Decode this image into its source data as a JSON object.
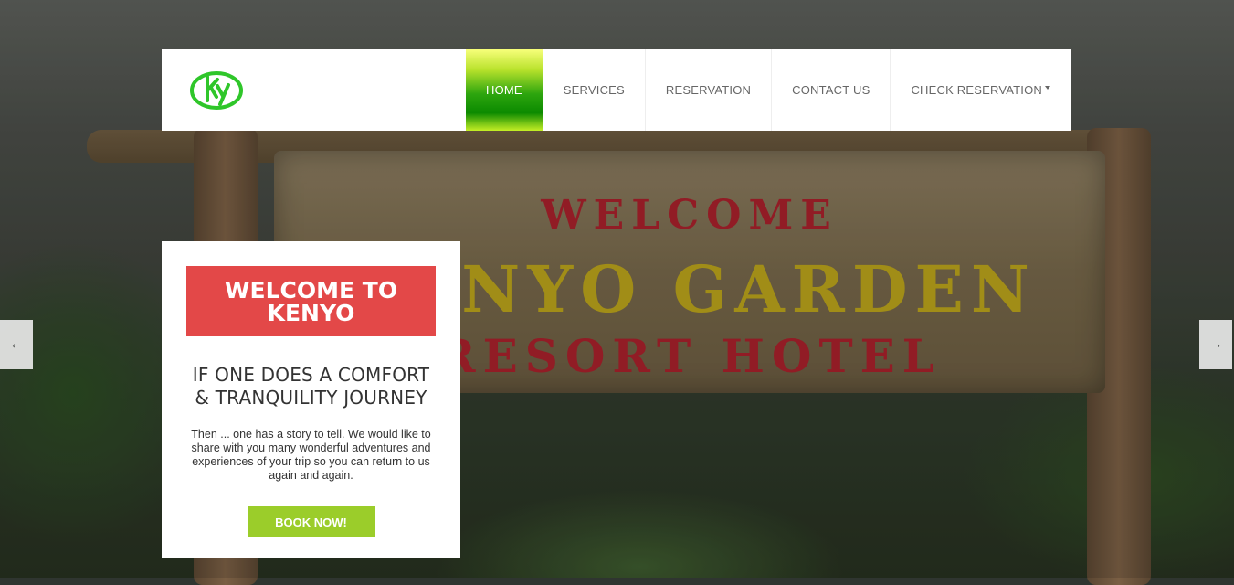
{
  "brand": {
    "logo_icon": "ky-circle-logo",
    "logo_color": "#2fc62a"
  },
  "nav": {
    "items": [
      {
        "label": "HOME",
        "active": true
      },
      {
        "label": "SERVICES"
      },
      {
        "label": "RESERVATION"
      },
      {
        "label": "CONTACT US"
      },
      {
        "label": "CHECK RESERVATION",
        "dropdown": true
      }
    ]
  },
  "hero": {
    "sign_line1": "WELCOME",
    "sign_line2": "KENYO GARDEN",
    "sign_line3": "RESORT HOTEL"
  },
  "carousel": {
    "prev_arrow": "←",
    "next_arrow": "→"
  },
  "card": {
    "title_line1": "WELCOME TO",
    "title_line2": "KENYO",
    "title_bg": "#e34848",
    "headline_line1": "IF ONE DOES A COMFORT",
    "headline_line2": "& TRANQUILITY JOURNEY",
    "description": "Then ... one has a story to tell. We would like to share with you many wonderful adventures and experiences of your trip so you can return to us again and again.",
    "button_label": "BOOK NOW!",
    "button_color": "#9bcd2a"
  }
}
